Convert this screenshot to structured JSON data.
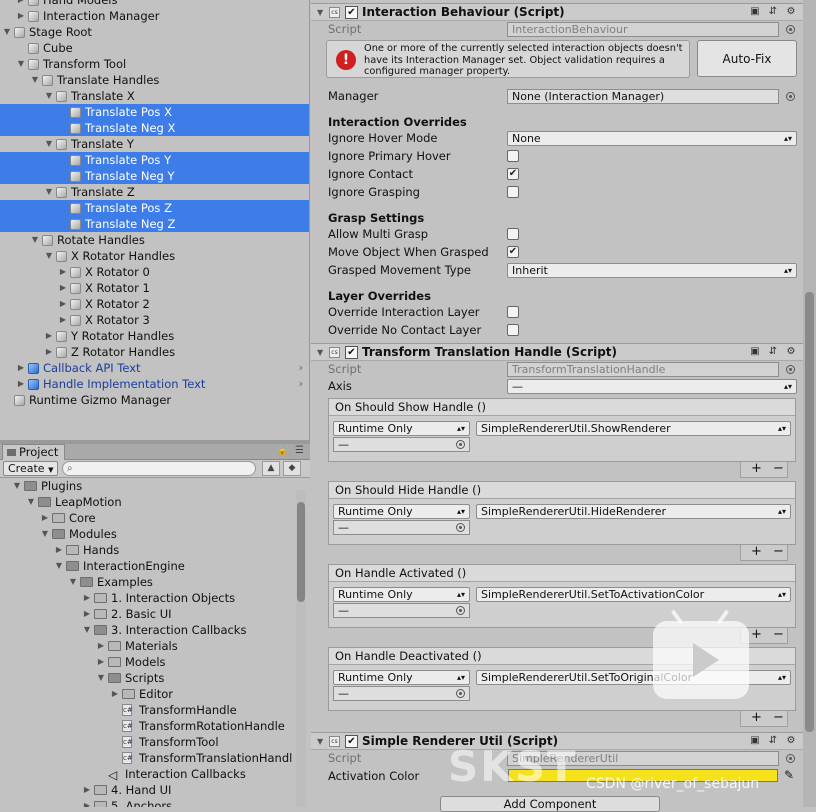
{
  "hierarchy": [
    {
      "label": "Hand Models",
      "indent": 2,
      "arrow": "▶",
      "icon": "cube"
    },
    {
      "label": "Interaction Manager",
      "indent": 2,
      "arrow": "▶",
      "icon": "cube"
    },
    {
      "label": "Stage Root",
      "indent": 1,
      "arrow": "▼",
      "icon": "cube"
    },
    {
      "label": "Cube",
      "indent": 2,
      "arrow": "",
      "icon": "cube"
    },
    {
      "label": "Transform Tool",
      "indent": 2,
      "arrow": "▼",
      "icon": "cube"
    },
    {
      "label": "Translate Handles",
      "indent": 3,
      "arrow": "▼",
      "icon": "cube"
    },
    {
      "label": "Translate X",
      "indent": 4,
      "arrow": "▼",
      "icon": "cube"
    },
    {
      "label": "Translate Pos X",
      "indent": 5,
      "arrow": "",
      "icon": "cube",
      "selected": true
    },
    {
      "label": "Translate Neg X",
      "indent": 5,
      "arrow": "",
      "icon": "cube",
      "selected": true
    },
    {
      "label": "Translate Y",
      "indent": 4,
      "arrow": "▼",
      "icon": "cube"
    },
    {
      "label": "Translate Pos Y",
      "indent": 5,
      "arrow": "",
      "icon": "cube",
      "selected": true
    },
    {
      "label": "Translate Neg Y",
      "indent": 5,
      "arrow": "",
      "icon": "cube",
      "selected": true
    },
    {
      "label": "Translate Z",
      "indent": 4,
      "arrow": "▼",
      "icon": "cube"
    },
    {
      "label": "Translate Pos Z",
      "indent": 5,
      "arrow": "",
      "icon": "cube",
      "selected": true
    },
    {
      "label": "Translate Neg Z",
      "indent": 5,
      "arrow": "",
      "icon": "cube",
      "selected": true
    },
    {
      "label": "Rotate Handles",
      "indent": 3,
      "arrow": "▼",
      "icon": "cube"
    },
    {
      "label": "X Rotator Handles",
      "indent": 4,
      "arrow": "▼",
      "icon": "cube"
    },
    {
      "label": "X Rotator 0",
      "indent": 5,
      "arrow": "▶",
      "icon": "cube"
    },
    {
      "label": "X Rotator 1",
      "indent": 5,
      "arrow": "▶",
      "icon": "cube"
    },
    {
      "label": "X Rotator 2",
      "indent": 5,
      "arrow": "▶",
      "icon": "cube"
    },
    {
      "label": "X Rotator 3",
      "indent": 5,
      "arrow": "▶",
      "icon": "cube"
    },
    {
      "label": "Y Rotator Handles",
      "indent": 4,
      "arrow": "▶",
      "icon": "cube"
    },
    {
      "label": "Z Rotator Handles",
      "indent": 4,
      "arrow": "▶",
      "icon": "cube"
    },
    {
      "label": "Callback API Text",
      "indent": 2,
      "arrow": "▶",
      "icon": "blue",
      "prefab": true
    },
    {
      "label": "Handle Implementation Text",
      "indent": 2,
      "arrow": "▶",
      "icon": "blue",
      "prefab": true
    },
    {
      "label": "Runtime Gizmo Manager",
      "indent": 1,
      "arrow": "",
      "icon": "cube"
    }
  ],
  "project": {
    "tab_label": "Project",
    "create_label": "Create",
    "items": [
      {
        "label": "Plugins",
        "indent": 1,
        "arrow": "▼",
        "icon": "folder"
      },
      {
        "label": "LeapMotion",
        "indent": 2,
        "arrow": "▼",
        "icon": "folder"
      },
      {
        "label": "Core",
        "indent": 3,
        "arrow": "▶",
        "icon": "folder"
      },
      {
        "label": "Modules",
        "indent": 3,
        "arrow": "▼",
        "icon": "folder"
      },
      {
        "label": "Hands",
        "indent": 4,
        "arrow": "▶",
        "icon": "folder"
      },
      {
        "label": "InteractionEngine",
        "indent": 4,
        "arrow": "▼",
        "icon": "folder"
      },
      {
        "label": "Examples",
        "indent": 5,
        "arrow": "▼",
        "icon": "folder"
      },
      {
        "label": "1. Interaction Objects",
        "indent": 6,
        "arrow": "▶",
        "icon": "folder"
      },
      {
        "label": "2. Basic UI",
        "indent": 6,
        "arrow": "▶",
        "icon": "folder"
      },
      {
        "label": "3. Interaction Callbacks",
        "indent": 6,
        "arrow": "▼",
        "icon": "folder"
      },
      {
        "label": "Materials",
        "indent": 7,
        "arrow": "▶",
        "icon": "folder"
      },
      {
        "label": "Models",
        "indent": 7,
        "arrow": "▶",
        "icon": "folder"
      },
      {
        "label": "Scripts",
        "indent": 7,
        "arrow": "▼",
        "icon": "folder"
      },
      {
        "label": "Editor",
        "indent": 8,
        "arrow": "▶",
        "icon": "folder"
      },
      {
        "label": "TransformHandle",
        "indent": 8,
        "arrow": "",
        "icon": "script"
      },
      {
        "label": "TransformRotationHandle",
        "indent": 8,
        "arrow": "",
        "icon": "script"
      },
      {
        "label": "TransformTool",
        "indent": 8,
        "arrow": "",
        "icon": "script"
      },
      {
        "label": "TransformTranslationHandl",
        "indent": 8,
        "arrow": "",
        "icon": "script"
      },
      {
        "label": "Interaction Callbacks",
        "indent": 7,
        "arrow": "",
        "icon": "unity"
      },
      {
        "label": "4. Hand UI",
        "indent": 6,
        "arrow": "▶",
        "icon": "folder"
      },
      {
        "label": "5. Anchors",
        "indent": 6,
        "arrow": "▶",
        "icon": "folder"
      }
    ]
  },
  "inspector": {
    "comp1": {
      "title": "Interaction Behaviour (Script)",
      "script_label": "Script",
      "script_value": "InteractionBehaviour",
      "warning": "One or more of the currently selected interaction objects doesn't have its Interaction Manager set.  Object validation requires a configured manager property.",
      "autofix_label": "Auto-Fix",
      "manager_label": "Manager",
      "manager_value": "None (Interaction Manager)",
      "overrides_header": "Interaction Overrides",
      "hover_mode_label": "Ignore Hover Mode",
      "hover_mode_value": "None",
      "primary_hover_label": "Ignore Primary Hover",
      "contact_label": "Ignore Contact",
      "grasping_label": "Ignore Grasping",
      "grasp_header": "Grasp Settings",
      "multi_grasp_label": "Allow Multi Grasp",
      "move_when_grasped_label": "Move Object When Grasped",
      "grasped_movement_label": "Grasped Movement Type",
      "grasped_movement_value": "Inherit",
      "layer_header": "Layer Overrides",
      "override_interaction_label": "Override Interaction Layer",
      "override_no_contact_label": "Override No Contact Layer"
    },
    "comp2": {
      "title": "Transform Translation Handle (Script)",
      "script_label": "Script",
      "script_value": "TransformTranslationHandle",
      "axis_label": "Axis",
      "axis_value": "—",
      "events": [
        {
          "header": "On Should Show Handle ()",
          "runtime": "Runtime Only",
          "function": "SimpleRendererUtil.ShowRenderer",
          "object": "—"
        },
        {
          "header": "On Should Hide Handle ()",
          "runtime": "Runtime Only",
          "function": "SimpleRendererUtil.HideRenderer",
          "object": "—"
        },
        {
          "header": "On Handle Activated ()",
          "runtime": "Runtime Only",
          "function": "SimpleRendererUtil.SetToActivationColor",
          "object": "—"
        },
        {
          "header": "On Handle Deactivated ()",
          "runtime": "Runtime Only",
          "function": "SimpleRendererUtil.SetToOriginalColor",
          "object": "—"
        }
      ]
    },
    "comp3": {
      "title": "Simple Renderer Util (Script)",
      "script_label": "Script",
      "script_value": "SimpleRendererUtil",
      "activation_label": "Activation Color"
    },
    "add_component_label": "Add Component"
  },
  "watermark": {
    "text": "CSDN @river_of_sebajun"
  },
  "colors": {
    "selection": "#3e7de7",
    "activation_color": "#f5e21a",
    "error": "#cf1f1f"
  }
}
